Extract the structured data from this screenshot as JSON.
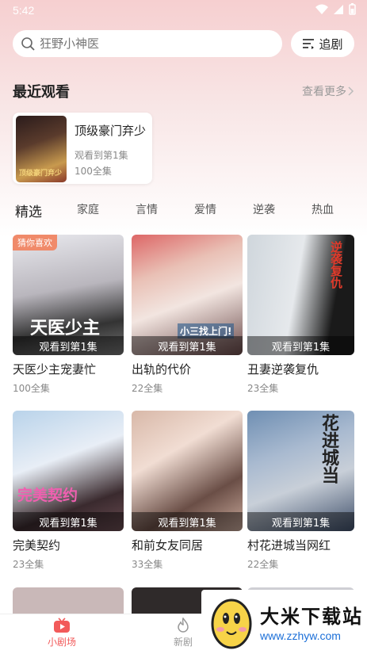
{
  "status_bar": {
    "time": "5:42"
  },
  "search": {
    "placeholder": "狂野小神医",
    "follow_label": "追剧"
  },
  "recent": {
    "title": "最近观看",
    "see_more": "查看更多",
    "item": {
      "title": "顶级豪门弃少",
      "progress": "观看到第1集",
      "total": "100全集",
      "cover_text": "顶级豪门弃少"
    }
  },
  "tabs": [
    "精选",
    "家庭",
    "言情",
    "爱情",
    "逆袭",
    "热血"
  ],
  "dramas": [
    {
      "title": "天医少主宠妻忙",
      "count": "100全集",
      "progress": "观看到第1集",
      "badge": "猜你喜欢",
      "art": "天医少主"
    },
    {
      "title": "出轨的代价",
      "count": "22全集",
      "progress": "观看到第1集",
      "badge": "",
      "art": "小三找上门!"
    },
    {
      "title": "丑妻逆袭复仇",
      "count": "23全集",
      "progress": "观看到第1集",
      "badge": "",
      "art": "逆袭复仇"
    },
    {
      "title": "完美契约",
      "count": "23全集",
      "progress": "观看到第1集",
      "badge": "",
      "art": "完美契约"
    },
    {
      "title": "和前女友同居",
      "count": "33全集",
      "progress": "观看到第1集",
      "badge": "",
      "art": ""
    },
    {
      "title": "村花进城当网红",
      "count": "22全集",
      "progress": "观看到第1集",
      "badge": "",
      "art": "花进城当"
    }
  ],
  "bottom_nav": [
    {
      "label": "小剧场",
      "icon": "play-tv-icon",
      "active": true
    },
    {
      "label": "新剧",
      "icon": "flame-icon",
      "active": false
    }
  ],
  "watermark": {
    "text": "大米下载站",
    "url": "www.zzhyw.com"
  },
  "colors": {
    "accent": "#f25a5a",
    "badge": "#f08a6a",
    "header_bg": "#f6cfd0"
  }
}
